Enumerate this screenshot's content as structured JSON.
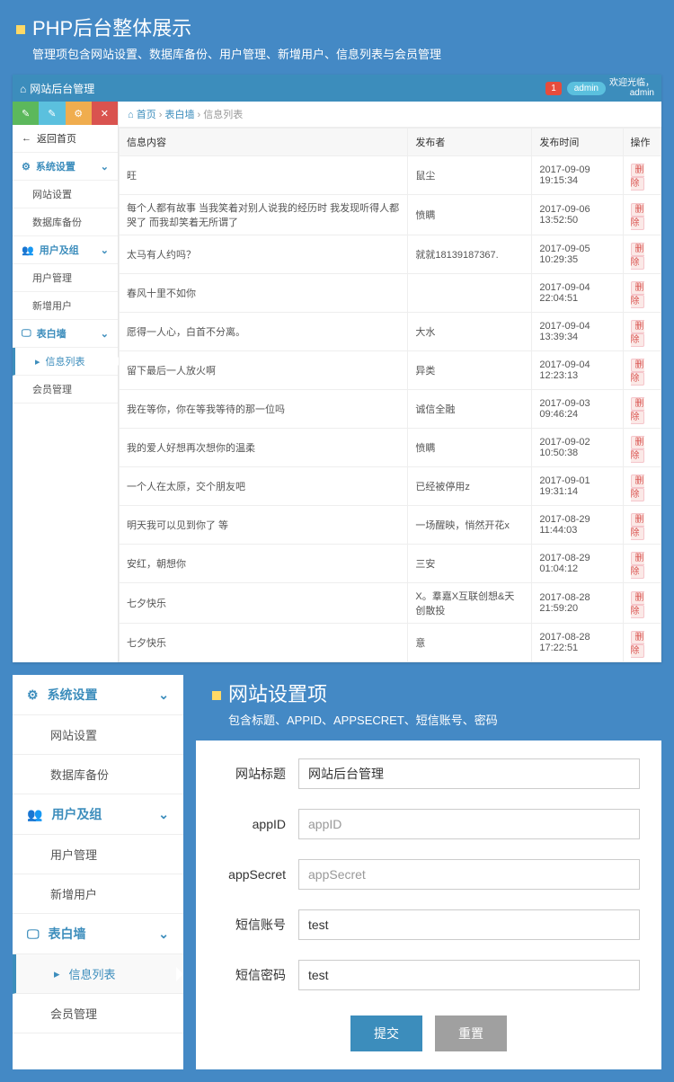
{
  "section1": {
    "title": "PHP后台整体展示",
    "sub": "管理项包含网站设置、数据库备份、用户管理、新增用户、信息列表与会员管理"
  },
  "header": {
    "title": "网站后台管理",
    "badge": "1",
    "admin_tag": "admin",
    "welcome": "欢迎光临，",
    "user": "admin"
  },
  "sidebar": {
    "back": "返回首页",
    "g1": "系统设置",
    "g1a": "网站设置",
    "g1b": "数据库备份",
    "g2": "用户及组",
    "g2a": "用户管理",
    "g2b": "新增用户",
    "g3": "表白墙",
    "g3a": "信息列表",
    "g3b": "会员管理"
  },
  "crumb": {
    "home": "首页",
    "mid": "表白墙",
    "cur": "信息列表"
  },
  "table": {
    "cols": [
      "信息内容",
      "发布者",
      "发布时间",
      "操作"
    ],
    "del": "删除",
    "rows": [
      {
        "c": "旺",
        "u": "鼠尘",
        "t": "2017-09-09 19:15:34"
      },
      {
        "c": "每个人都有故事 当我笑着对别人说我的经历时 我发现听得人都哭了 而我却笑着无所谓了",
        "u": "愤瞒",
        "t": "2017-09-06 13:52:50"
      },
      {
        "c": "太马有人约吗？",
        "u": "就就18139187367.",
        "t": "2017-09-05 10:29:35"
      },
      {
        "c": "春风十里不如你",
        "u": "",
        "t": "2017-09-04 22:04:51"
      },
      {
        "c": "愿得一人心，白首不分离。",
        "u": "大水",
        "t": "2017-09-04 13:39:34"
      },
      {
        "c": "留下最后一人放火啊",
        "u": "异类",
        "t": "2017-09-04 12:23:13"
      },
      {
        "c": "我在等你，你在等我等待的那一位吗",
        "u": "诚信全融",
        "t": "2017-09-03 09:46:24"
      },
      {
        "c": "我的爱人好想再次想你的温柔",
        "u": "愤瞒",
        "t": "2017-09-02 10:50:38"
      },
      {
        "c": "一个人在太原，交个朋友吧",
        "u": "已经被停用z",
        "t": "2017-09-01 19:31:14"
      },
      {
        "c": "明天我可以见到你了 等",
        "u": "一场醒映，悄然开花x",
        "t": "2017-08-29 11:44:03"
      },
      {
        "c": "安红，朝想你",
        "u": "三安",
        "t": "2017-08-29 01:04:12"
      },
      {
        "c": "七夕快乐",
        "u": "X。羣嘉X互联创想&天创散投",
        "t": "2017-08-28 21:59:20"
      },
      {
        "c": "七夕快乐",
        "u": "意",
        "t": "2017-08-28 17:22:51"
      }
    ]
  },
  "section2": {
    "title": "网站设置项",
    "sub": "包含标题、APPID、APPSECRET、短信账号、密码"
  },
  "form": {
    "f1": {
      "label": "网站标题",
      "value": "网站后台管理"
    },
    "f2": {
      "label": "appID",
      "placeholder": "appID"
    },
    "f3": {
      "label": "appSecret",
      "placeholder": "appSecret"
    },
    "f4": {
      "label": "短信账号",
      "value": "test"
    },
    "f5": {
      "label": "短信密码",
      "value": "test"
    },
    "submit": "提交",
    "reset": "重置"
  }
}
